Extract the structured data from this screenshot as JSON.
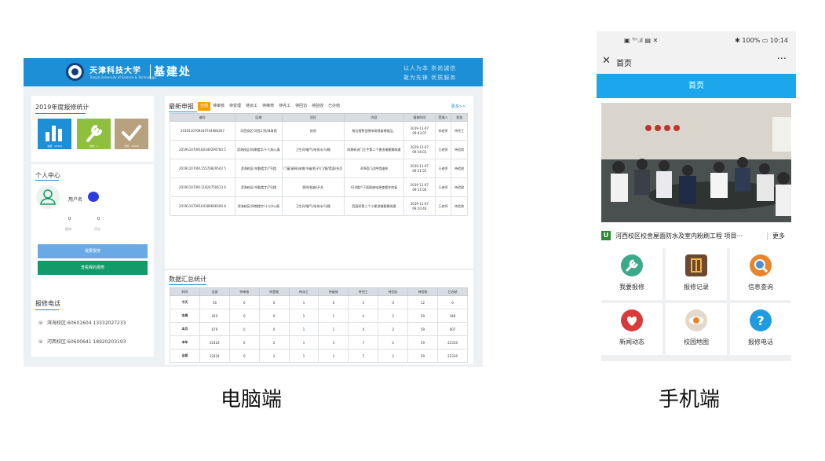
{
  "pc": {
    "header": {
      "university": "天津科技大学",
      "university_en": "Tianjin University of Science & Technology",
      "department": "基建处",
      "slogan_line1": "以人为本 崇尚诚信",
      "slogan_line2": "敢为先锋 优质服务"
    },
    "stats": {
      "title": "2019年度报修统计",
      "total": "总量：22424",
      "pending": "待修：3",
      "done": "已修：22316"
    },
    "personal": {
      "title": "个人中心",
      "username_label": "用户名",
      "repairs_count": "0",
      "repairs_label": "报修",
      "reviews_count": "0",
      "reviews_label": "评论",
      "report_button": "我要报修",
      "my_reports_button": "查看我的报修"
    },
    "phone": {
      "title": "报修电话",
      "binhai": "滨海校区:60601604 13332027233",
      "hexi": "河西校区:60600641 18920203193"
    },
    "latest": {
      "title": "最新申报",
      "more": "更多>>",
      "tabs": [
        "全部",
        "待审核",
        "待受理",
        "待派工",
        "待维修",
        "待完工",
        "待回访",
        "待验收",
        "已办结"
      ],
      "headers": [
        "编号",
        "区域",
        "项目",
        "内容",
        "报修时间",
        "受理人",
        "状态"
      ],
      "rows": [
        [
          "2019110709430744480267",
          "河西校区/河西2 院/体育馆",
          "其他",
          "南边报警会晚响常规桌椅物品。",
          "2019-11-07 09:43:07",
          "李老师",
          "待完工"
        ],
        [
          "2019110709160349294783 5",
          "滨海校区/四期楼字/十七街公寓",
          "卫生间/暖气/给排水/马桶",
          "四期研进门左手第二个便池堵塞需疏通",
          "2019-11-07 09:16:03",
          "王老师",
          "待验收"
        ],
        [
          "2019110709115570829542 5",
          "滨海校区/辛勤楼字/7号楼",
          "门窗/桌椅/床铺/书桌/柜子/门/镜/墙面/合页",
          "306宿门边呼墙维修",
          "2019-11-07 09:11:55",
          "王老师",
          "待验收"
        ],
        [
          "2019110709111824750613 6",
          "滨海校区/辛勤楼字/7号楼",
          "照明/插座/开关",
          "414楼户下面插座电源查看并修复",
          "2019-11-07 09:11:00",
          "王老师",
          "待验收"
        ],
        [
          "2019110709104389666500 8",
          "滨海校区/四期楼字/十七A公寓",
          "卫生间/暖气/给排水/马桶",
          "西面研第三个小便池堵塞需疏通",
          "2019-11-07 09:10:44",
          "王老师",
          "待验收"
        ]
      ]
    },
    "summary": {
      "title": "数据汇总统计",
      "headers": [
        "时间",
        "全部",
        "待审核",
        "待受理",
        "待派工",
        "待维修",
        "待完工",
        "待回访",
        "待验收",
        "已办结"
      ],
      "rows": [
        [
          "今天",
          "16",
          "0",
          "0",
          "1",
          "0",
          "3",
          "0",
          "12",
          "0"
        ],
        [
          "本周",
          "420",
          "0",
          "0",
          "1",
          "1",
          "4",
          "2",
          "59",
          "349"
        ],
        [
          "本月",
          "679",
          "0",
          "0",
          "1",
          "1",
          "4",
          "2",
          "59",
          "607"
        ],
        [
          "本年",
          "22424",
          "0",
          "2",
          "1",
          "3",
          "7",
          "2",
          "59",
          "22316"
        ],
        [
          "全部",
          "22424",
          "0",
          "2",
          "1",
          "3",
          "7",
          "2",
          "59",
          "22316"
        ]
      ]
    }
  },
  "mobile": {
    "status_left": "▣ ᵀᴴ.ıl ▤ ✕",
    "status_right": "✱ 100% ▭ 10:14",
    "nav_title": "首页",
    "nav_more": "···",
    "page_title": "首页",
    "headline_badge": "U",
    "headline": "河西校区校舍屋面防水及室内粉刷工程 项目···",
    "headline_more": "更多",
    "grid": [
      {
        "label": "我要报修",
        "icon": "wrench-icon",
        "color": "#3aaa8a"
      },
      {
        "label": "报修记录",
        "icon": "notebook-icon",
        "color": "#6d4a2f"
      },
      {
        "label": "信息查询",
        "icon": "magnifier-icon",
        "color": "#e9842a"
      },
      {
        "label": "新闻动态",
        "icon": "heart-icon",
        "color": "#d93b3b"
      },
      {
        "label": "校园地图",
        "icon": "eye-icon",
        "color": "#e3d9c8"
      },
      {
        "label": "报修电话",
        "icon": "question-icon",
        "color": "#1f9be0"
      }
    ]
  },
  "captions": {
    "pc": "电脑端",
    "mobile": "手机端"
  },
  "colors": {
    "header_blue": "#1c8fd6",
    "tab_orange": "#f7a000",
    "mobile_blue": "#1ca7ec",
    "green_button": "#139a6a"
  }
}
